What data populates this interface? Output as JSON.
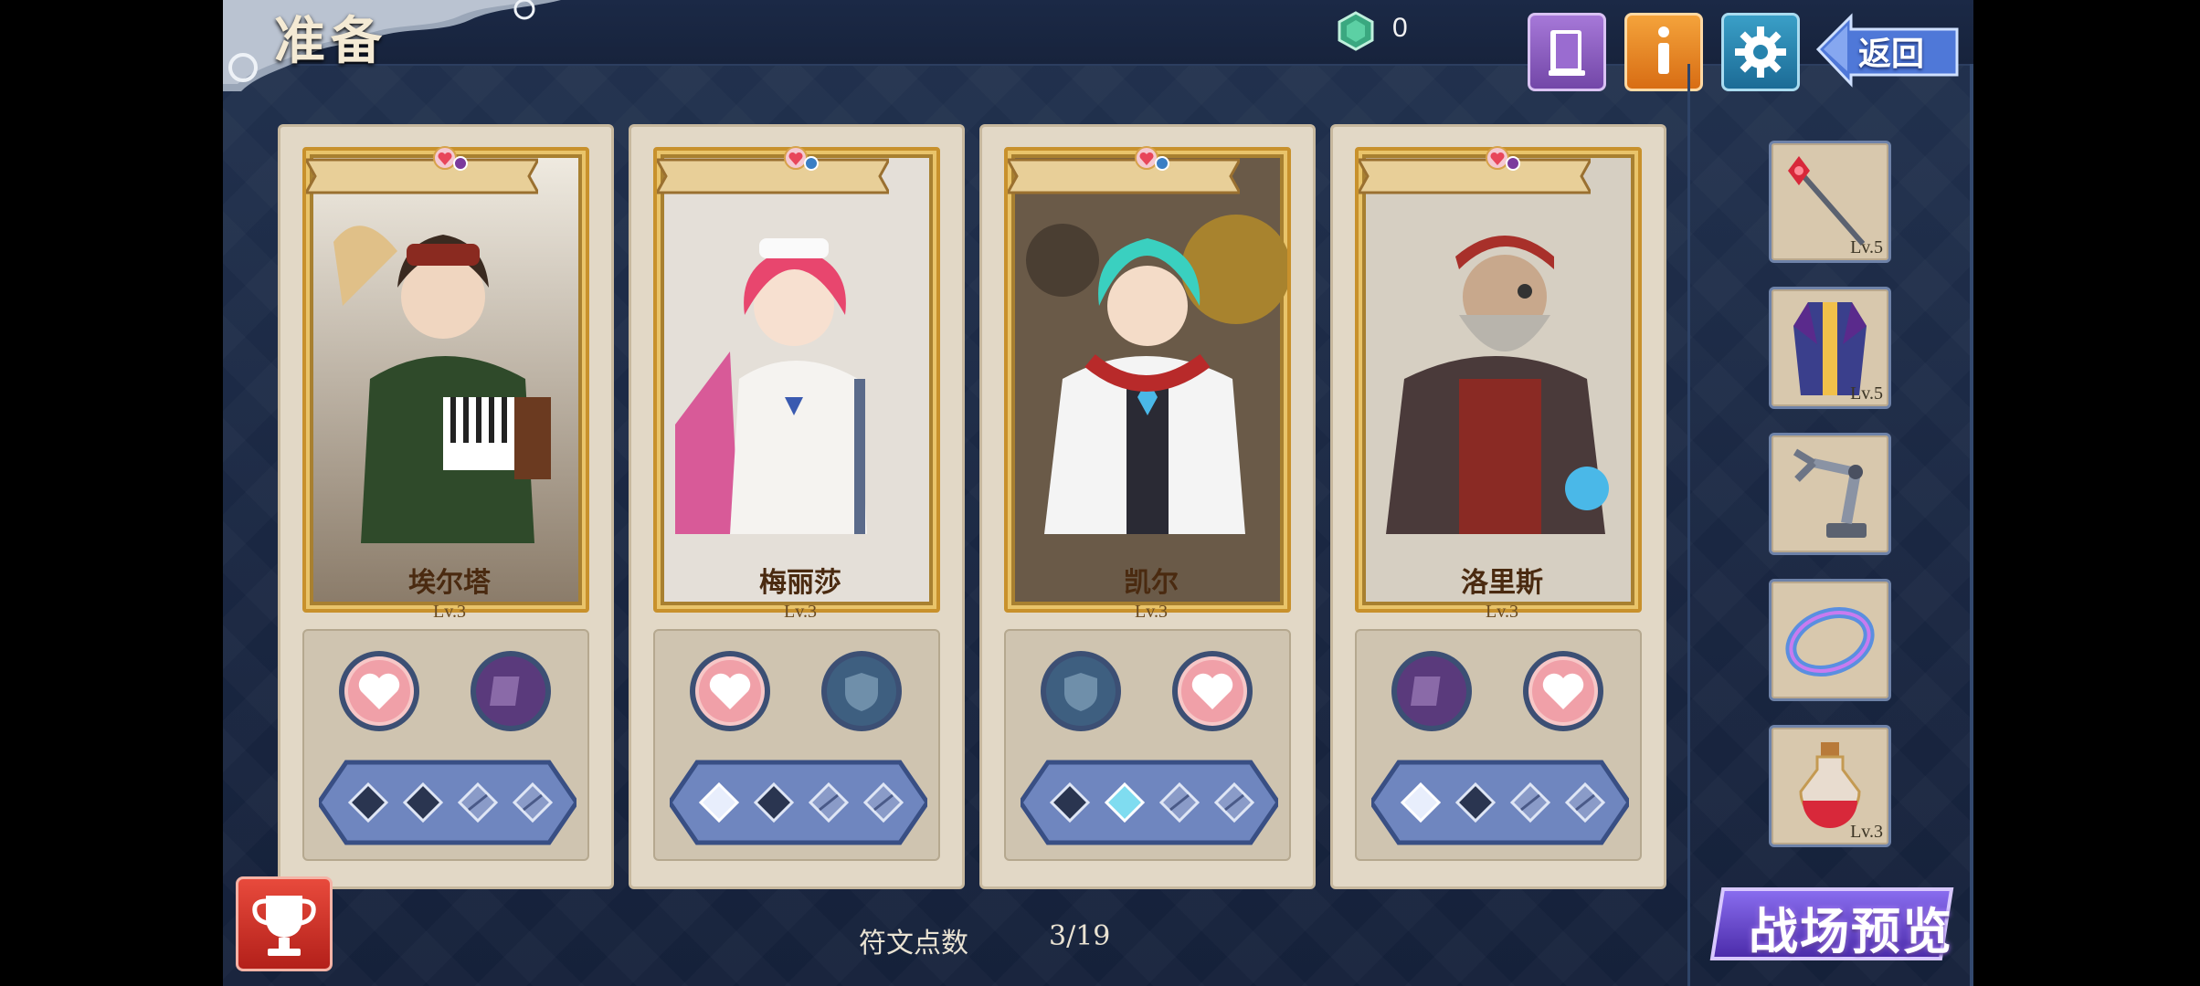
{
  "header": {
    "title": "准备",
    "currency_value": "0",
    "back_label": "返回",
    "icons": [
      "book-icon",
      "info-icon",
      "gear-icon",
      "back-arrow-icon",
      "rune-gem-icon"
    ]
  },
  "characters": [
    {
      "name": "埃尔塔",
      "level": "Lv.3",
      "orbs": [
        "heart",
        "scroll"
      ],
      "pips": [
        "empty",
        "empty",
        "locked",
        "locked"
      ],
      "accent": "#7b3a9c"
    },
    {
      "name": "梅丽莎",
      "level": "Lv.3",
      "orbs": [
        "heart",
        "shield"
      ],
      "pips": [
        "lit",
        "empty",
        "locked",
        "locked"
      ],
      "accent": "#3a7ec4"
    },
    {
      "name": "凯尔",
      "level": "Lv.3",
      "orbs": [
        "shield",
        "heart"
      ],
      "pips": [
        "empty",
        "lit-cyan",
        "locked",
        "locked"
      ],
      "accent": "#3a7ec4"
    },
    {
      "name": "洛里斯",
      "level": "Lv.3",
      "orbs": [
        "scroll",
        "heart"
      ],
      "pips": [
        "lit",
        "empty",
        "locked",
        "locked"
      ],
      "accent": "#7b3a9c"
    }
  ],
  "equipment": [
    {
      "item": "staff-icon",
      "level": "Lv.5"
    },
    {
      "item": "robe-icon",
      "level": "Lv.5"
    },
    {
      "item": "mech-arm-icon",
      "level": ""
    },
    {
      "item": "ring-icon",
      "level": ""
    },
    {
      "item": "potion-icon",
      "level": "Lv.3"
    }
  ],
  "footer": {
    "rune_points_label": "符文点数",
    "rune_points_value": "3/19",
    "preview_label": "战场预览"
  },
  "colors": {
    "background": "#1a2742",
    "panel": "#e2d8c6",
    "frame_gold": "#c8912c",
    "heart_red": "#e8465a",
    "back_blue": "#4f78d8",
    "preview_purple": "#6a4bd0"
  }
}
